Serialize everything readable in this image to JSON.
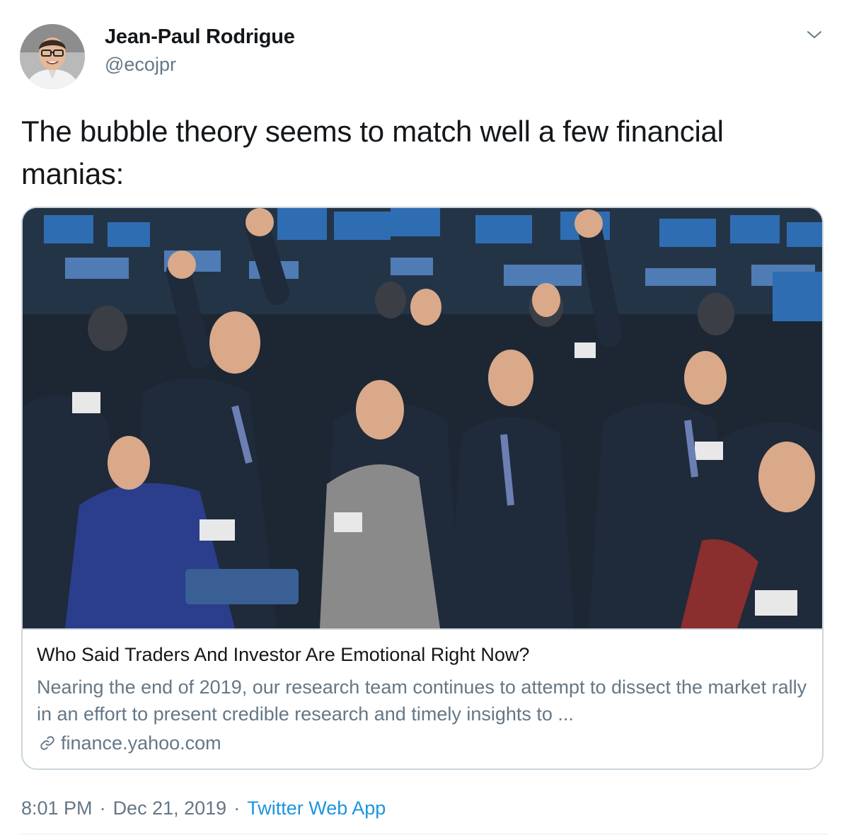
{
  "author": {
    "name": "Jean-Paul Rodrigue",
    "handle": "@ecojpr"
  },
  "more_icon": "chevron-down-icon",
  "tweet": {
    "text": "The bubble theory seems to match well a few financial manias:"
  },
  "card": {
    "title": "Who Said Traders And Investor Are Emotional Right Now?",
    "description": "Nearing the end of 2019, our research team continues to attempt to dissect the market rally in an effort to present credible research and timely insights to ...",
    "domain": "finance.yahoo.com",
    "domain_icon": "link-icon"
  },
  "meta": {
    "time": "8:01 PM",
    "separator": "·",
    "date": "Dec 21, 2019",
    "source": "Twitter Web App"
  },
  "colors": {
    "text_primary": "#14171a",
    "text_secondary": "#657786",
    "link": "#1b95e0",
    "border": "#ccd6dd"
  }
}
